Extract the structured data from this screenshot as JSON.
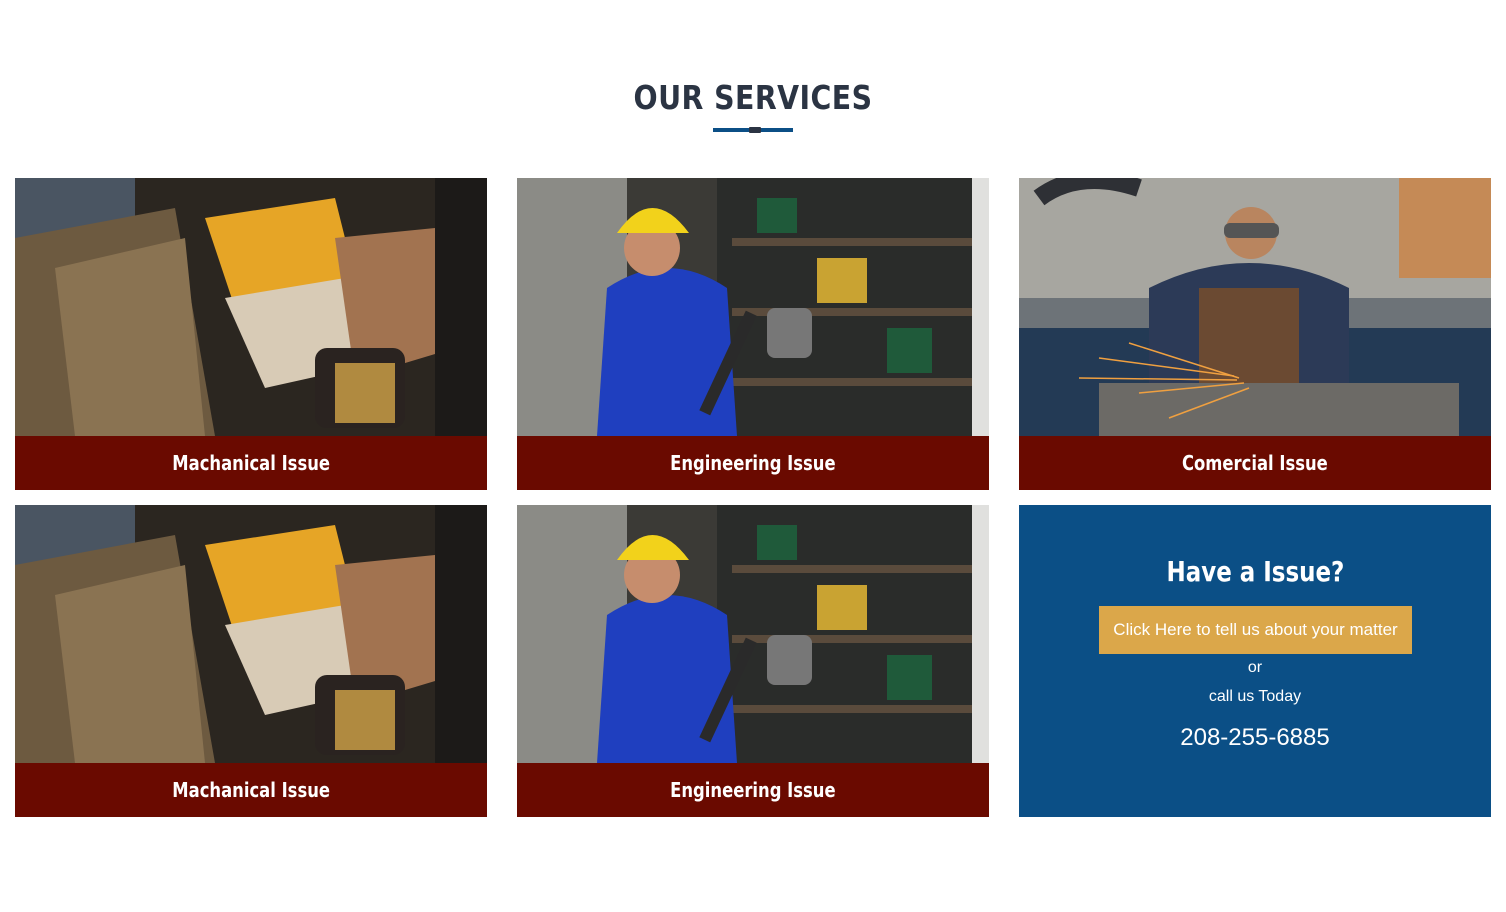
{
  "section": {
    "title": "OUR SERVICES"
  },
  "services": [
    {
      "label": "Machanical Issue",
      "image": "worker-gloves-drill"
    },
    {
      "label": "Engineering Issue",
      "image": "worker-hardhat-hammer"
    },
    {
      "label": "Comercial Issue",
      "image": "worker-grinder-sparks"
    },
    {
      "label": "Machanical Issue",
      "image": "worker-gloves-drill"
    },
    {
      "label": "Engineering Issue",
      "image": "worker-hardhat-hammer"
    }
  ],
  "cta": {
    "title": "Have a Issue?",
    "button_label": "Click Here to tell us about your matter",
    "or_text": "or",
    "call_text": "call us Today",
    "phone": "208-255-6885"
  },
  "colors": {
    "caption_bg": "#6a0a00",
    "cta_bg": "#0b4f86",
    "button_bg": "#dba74a",
    "heading": "#2b3443"
  }
}
